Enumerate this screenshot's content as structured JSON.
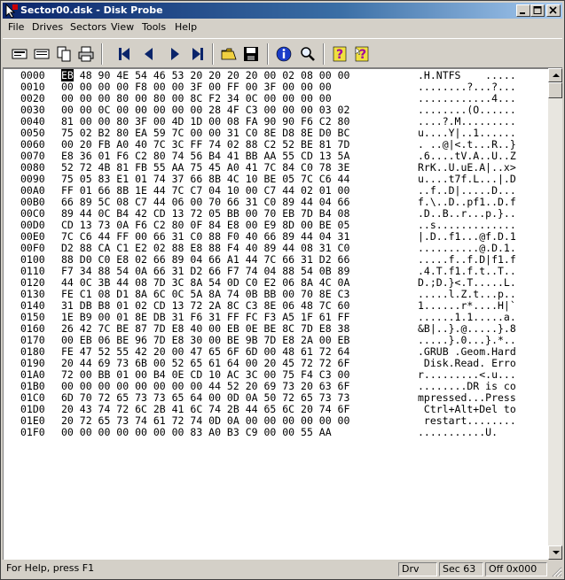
{
  "window": {
    "title": "Sector00.dsk - Disk Probe",
    "icon": "disk-probe-icon"
  },
  "menu": [
    "File",
    "Drives",
    "Sectors",
    "View",
    "Tools",
    "Help"
  ],
  "toolbar": {
    "buttons": [
      "read-sector-icon",
      "write-sector-icon",
      "copy-icon",
      "print-icon",
      "first-sector-icon",
      "previous-sector-icon",
      "next-sector-icon",
      "last-sector-icon",
      "open-icon",
      "save-icon",
      "info-icon",
      "search-icon",
      "help-icon",
      "context-help-icon"
    ]
  },
  "hexdump": {
    "selected_byte": "EB",
    "rows": [
      {
        "offset": "0000",
        "bytes": "48 90 4E 54 46 53 20 20 20 20 00 02 08 00 00",
        "ascii": ".H.NTFS    ....."
      },
      {
        "offset": "0010",
        "bytes": "00 00 00 00 F8 00 00 3F 00 FF 00 3F 00 00 00",
        "ascii": "........?...?..."
      },
      {
        "offset": "0020",
        "bytes": "00 00 00 80 00 80 00 8C F2 34 0C 00 00 00 00",
        "ascii": "............4..."
      },
      {
        "offset": "0030",
        "bytes": "00 00 0C 00 00 00 00 00 28 4F C3 00 00 00 03 02",
        "ascii": "........(O......"
      },
      {
        "offset": "0040",
        "bytes": "81 00 00 80 3F 00 4D 1D 00 08 FA 90 90 F6 C2 80",
        "ascii": "....?.M........."
      },
      {
        "offset": "0050",
        "bytes": "75 02 B2 80 EA 59 7C 00 00 31 C0 8E D8 8E D0 BC",
        "ascii": "u....Y|..1......"
      },
      {
        "offset": "0060",
        "bytes": "00 20 FB A0 40 7C 3C FF 74 02 88 C2 52 BE 81 7D",
        "ascii": ". ..@|<.t...R..}"
      },
      {
        "offset": "0070",
        "bytes": "E8 36 01 F6 C2 80 74 56 B4 41 BB AA 55 CD 13 5A",
        "ascii": ".6....tV.A..U..Z"
      },
      {
        "offset": "0080",
        "bytes": "52 72 4B 81 FB 55 AA 75 45 A0 41 7C 84 C0 78 3E",
        "ascii": "RrK..U.uE.A|..x>"
      },
      {
        "offset": "0090",
        "bytes": "75 05 83 E1 01 74 37 66 8B 4C 10 BE 05 7C C6 44",
        "ascii": "u....t7f.L...|.D"
      },
      {
        "offset": "00A0",
        "bytes": "FF 01 66 8B 1E 44 7C C7 04 10 00 C7 44 02 01 00",
        "ascii": "..f..D|.....D..."
      },
      {
        "offset": "00B0",
        "bytes": "66 89 5C 08 C7 44 06 00 70 66 31 C0 89 44 04 66",
        "ascii": "f.\\..D..pf1..D.f"
      },
      {
        "offset": "00C0",
        "bytes": "89 44 0C B4 42 CD 13 72 05 BB 00 70 EB 7D B4 08",
        "ascii": ".D..B..r...p.}.."
      },
      {
        "offset": "00D0",
        "bytes": "CD 13 73 0A F6 C2 80 0F 84 E8 00 E9 8D 00 BE 05",
        "ascii": "..s............."
      },
      {
        "offset": "00E0",
        "bytes": "7C C6 44 FF 00 66 31 C0 88 F0 40 66 89 44 04 31",
        "ascii": "|.D..f1...@f.D.1"
      },
      {
        "offset": "00F0",
        "bytes": "D2 88 CA C1 E2 02 88 E8 88 F4 40 89 44 08 31 C0",
        "ascii": "..........@.D.1."
      },
      {
        "offset": "0100",
        "bytes": "88 D0 C0 E8 02 66 89 04 66 A1 44 7C 66 31 D2 66",
        "ascii": ".....f..f.D|f1.f"
      },
      {
        "offset": "0110",
        "bytes": "F7 34 88 54 0A 66 31 D2 66 F7 74 04 88 54 0B 89",
        "ascii": ".4.T.f1.f.t..T.."
      },
      {
        "offset": "0120",
        "bytes": "44 0C 3B 44 08 7D 3C 8A 54 0D C0 E2 06 8A 4C 0A",
        "ascii": "D.;D.}<.T.....L."
      },
      {
        "offset": "0130",
        "bytes": "FE C1 08 D1 8A 6C 0C 5A 8A 74 0B BB 00 70 8E C3",
        "ascii": ".....l.Z.t...p.."
      },
      {
        "offset": "0140",
        "bytes": "31 DB B8 01 02 CD 13 72 2A 8C C3 8E 06 48 7C 60",
        "ascii": "1......r*....H|`"
      },
      {
        "offset": "0150",
        "bytes": "1E B9 00 01 8E DB 31 F6 31 FF FC F3 A5 1F 61 FF",
        "ascii": "......1.1.....a."
      },
      {
        "offset": "0160",
        "bytes": "26 42 7C BE 87 7D E8 40 00 EB 0E BE 8C 7D E8 38",
        "ascii": "&B|..}.@.....}.8"
      },
      {
        "offset": "0170",
        "bytes": "00 EB 06 BE 96 7D E8 30 00 BE 9B 7D E8 2A 00 EB",
        "ascii": ".....}.0...}.*.."
      },
      {
        "offset": "0180",
        "bytes": "FE 47 52 55 42 20 00 47 65 6F 6D 00 48 61 72 64",
        "ascii": ".GRUB .Geom.Hard"
      },
      {
        "offset": "0190",
        "bytes": "20 44 69 73 6B 00 52 65 61 64 00 20 45 72 72 6F",
        "ascii": " Disk.Read. Erro"
      },
      {
        "offset": "01A0",
        "bytes": "72 00 BB 01 00 B4 0E CD 10 AC 3C 00 75 F4 C3 00",
        "ascii": "r.........<.u..."
      },
      {
        "offset": "01B0",
        "bytes": "00 00 00 00 00 00 00 00 44 52 20 69 73 20 63 6F",
        "ascii": "........DR is co"
      },
      {
        "offset": "01C0",
        "bytes": "6D 70 72 65 73 73 65 64 00 0D 0A 50 72 65 73 73",
        "ascii": "mpressed...Press"
      },
      {
        "offset": "01D0",
        "bytes": "20 43 74 72 6C 2B 41 6C 74 2B 44 65 6C 20 74 6F",
        "ascii": " Ctrl+Alt+Del to"
      },
      {
        "offset": "01E0",
        "bytes": "20 72 65 73 74 61 72 74 0D 0A 00 00 00 00 00 00",
        "ascii": " restart........"
      },
      {
        "offset": "01F0",
        "bytes": "00 00 00 00 00 00 00 83 A0 B3 C9 00 00 55 AA",
        "ascii": "...........U."
      }
    ]
  },
  "status": {
    "help": "For Help, press F1",
    "drive": "Drv",
    "sector": "Sec 63",
    "offset": "Off 0x000"
  }
}
